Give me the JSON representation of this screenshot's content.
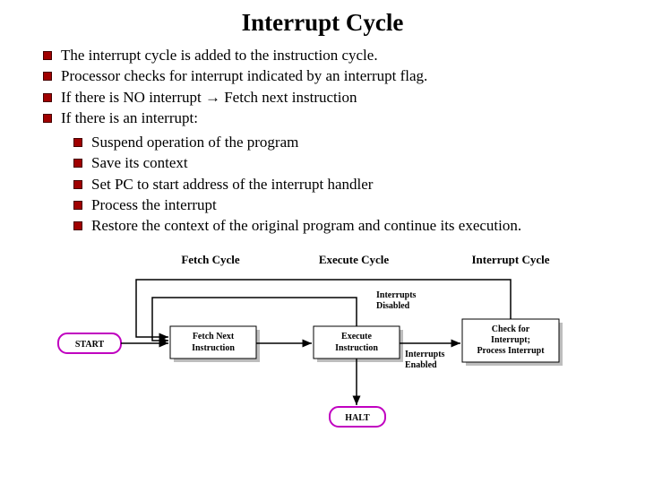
{
  "title": "Interrupt Cycle",
  "bullets": {
    "b1": "The interrupt cycle is added to the instruction cycle.",
    "b2": "Processor checks for interrupt indicated by an interrupt flag.",
    "b3": "If there is NO interrupt → Fetch next instruction",
    "b4": "If there is an interrupt:"
  },
  "sub": {
    "s1": "Suspend operation of the program",
    "s2": "Save its context",
    "s3": "Set PC to start address of the interrupt handler",
    "s4": "Process the interrupt",
    "s5": "Restore the context of the original program and continue its execution."
  },
  "diagram": {
    "labelFetch": "Fetch Cycle",
    "labelExecute": "Execute Cycle",
    "labelInterrupt": "Interrupt Cycle",
    "start": "START",
    "halt": "HALT",
    "boxFetch1": "Fetch Next",
    "boxFetch2": "Instruction",
    "boxExec1": "Execute",
    "boxExec2": "Instruction",
    "boxInt1": "Check for",
    "boxInt2": "Interrupt;",
    "boxInt3": "Process Interrupt",
    "edgeDisabled1": "Interrupts",
    "edgeDisabled2": "Disabled",
    "edgeEnabled1": "Interrupts",
    "edgeEnabled2": "Enabled"
  }
}
